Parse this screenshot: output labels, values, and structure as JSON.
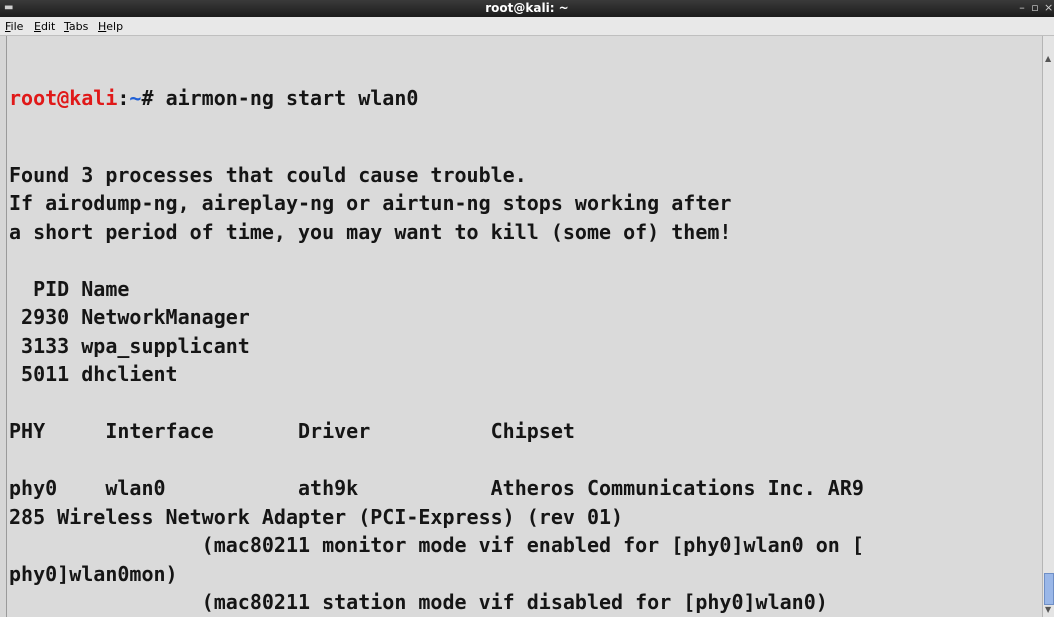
{
  "window": {
    "title": "root@kali: ~"
  },
  "menu": [
    {
      "label": "File",
      "accel": "F"
    },
    {
      "label": "Edit",
      "accel": "E"
    },
    {
      "label": "Tabs",
      "accel": "T"
    },
    {
      "label": "Help",
      "accel": "H"
    }
  ],
  "prompt": {
    "user": "root@kali",
    "sep": ":",
    "path": "~",
    "symbol": "# ",
    "command": "airmon-ng start wlan0"
  },
  "output": [
    "Found 3 processes that could cause trouble.",
    "If airodump-ng, aireplay-ng or airtun-ng stops working after",
    "a short period of time, you may want to kill (some of) them!",
    "",
    "  PID Name",
    " 2930 NetworkManager",
    " 3133 wpa_supplicant",
    " 5011 dhclient",
    "",
    "PHY     Interface       Driver          Chipset",
    "",
    "phy0    wlan0           ath9k           Atheros Communications Inc. AR9",
    "285 Wireless Network Adapter (PCI-Express) (rev 01)",
    "                (mac80211 monitor mode vif enabled for [phy0]wlan0 on [",
    "phy0]wlan0mon)",
    "                (mac80211 station mode vif disabled for [phy0]wlan0)"
  ]
}
